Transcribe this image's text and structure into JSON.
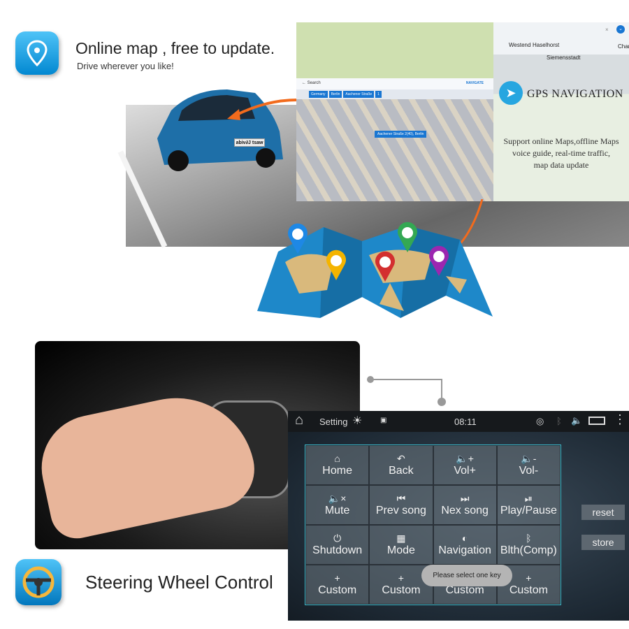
{
  "section_map": {
    "title": "Online map , free to update.",
    "subtitle": "Drive wherever you like!",
    "icon": "map-pin-icon",
    "car_plate": "abiv∂J tsaw",
    "map_screenshot": {
      "search_label": "Search",
      "navigate_label": "NAVIGATE",
      "chips": [
        "Germany",
        "Berlin",
        "Aachener Straße",
        "1"
      ],
      "address_label": "Aachener Straße 2(40), Berlin",
      "places": [
        "Westend",
        "Haselhorst",
        "Siemensstadt",
        "Char"
      ]
    },
    "gps_panel": {
      "title": "GPS NAVIGATION",
      "description_lines": [
        "Support online Maps,offline Maps",
        "voice guide, real-time traffic,",
        "map data update"
      ]
    },
    "pin_colors": [
      "#1e88e5",
      "#f4b400",
      "#34a853",
      "#d32f2f",
      "#9c27b0"
    ]
  },
  "section_steering": {
    "title": "Steering Wheel Control",
    "icon": "steering-wheel-icon",
    "screen": {
      "status_bar": {
        "app_label": "Setting",
        "time": "08:11"
      },
      "keys": [
        {
          "icon": "home-icon",
          "glyph": "⌂",
          "label": "Home"
        },
        {
          "icon": "back-icon",
          "glyph": "↶",
          "label": "Back"
        },
        {
          "icon": "volume-up-icon",
          "glyph": "🔈+",
          "label": "Vol+"
        },
        {
          "icon": "volume-down-icon",
          "glyph": "🔈-",
          "label": "Vol-"
        },
        {
          "icon": "mute-icon",
          "glyph": "🔈×",
          "label": "Mute"
        },
        {
          "icon": "prev-icon",
          "glyph": "⏮",
          "label": "Prev song"
        },
        {
          "icon": "next-icon",
          "glyph": "⏭",
          "label": "Nex song"
        },
        {
          "icon": "play-pause-icon",
          "glyph": "⏯",
          "label": "Play/Pause"
        },
        {
          "icon": "power-icon",
          "glyph": "⏻",
          "label": "Shutdown"
        },
        {
          "icon": "mode-icon",
          "glyph": "▦",
          "label": "Mode"
        },
        {
          "icon": "compass-icon",
          "glyph": "◐",
          "label": "Navigation"
        },
        {
          "icon": "bluetooth-icon",
          "glyph": "ᛒ",
          "label": "Blth(Comp)"
        },
        {
          "icon": "plus-icon",
          "glyph": "+",
          "label": "Custom"
        },
        {
          "icon": "plus-icon",
          "glyph": "+",
          "label": "Custom"
        },
        {
          "icon": "plus-icon",
          "glyph": "+",
          "label": "Custom"
        },
        {
          "icon": "plus-icon",
          "glyph": "+",
          "label": "Custom"
        }
      ],
      "reset_label": "reset",
      "store_label": "store",
      "toast": "Please select one key"
    }
  }
}
